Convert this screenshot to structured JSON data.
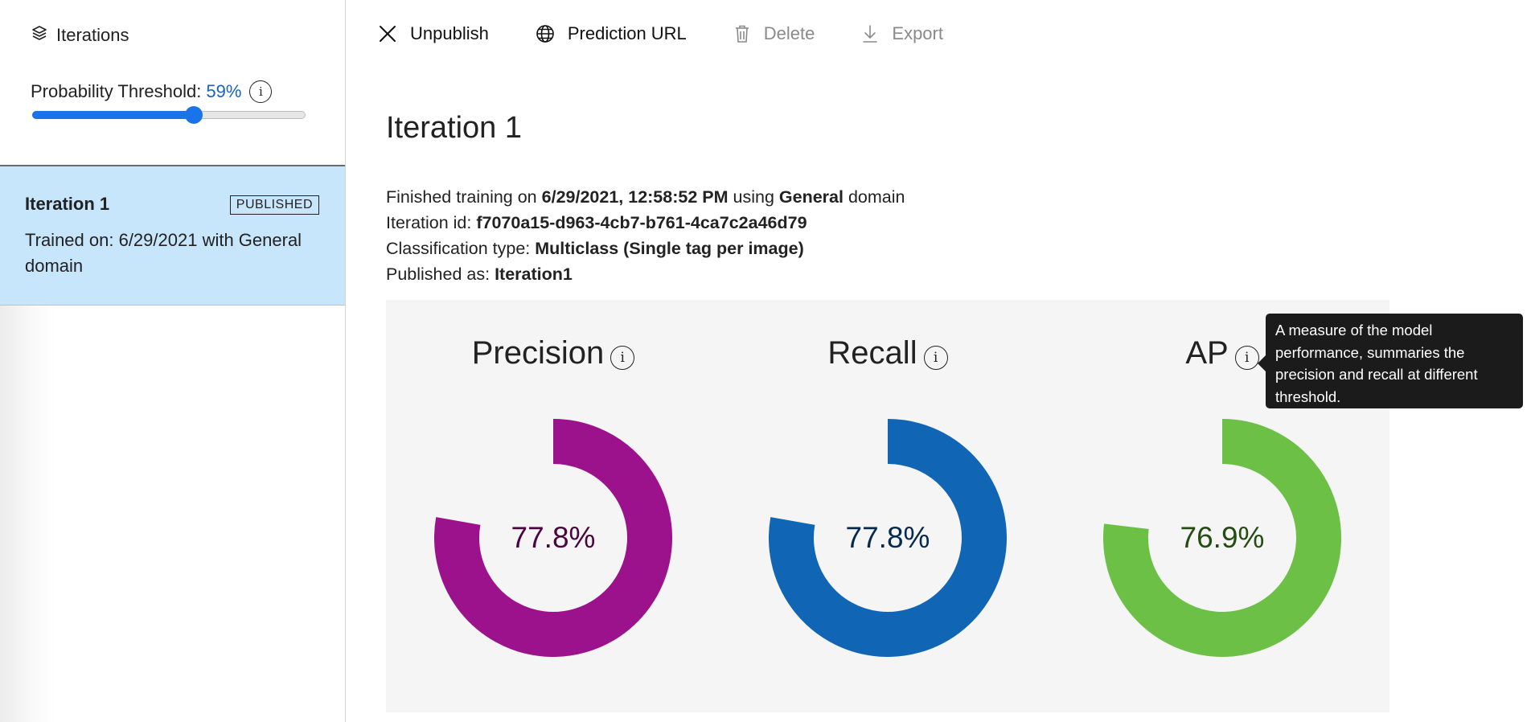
{
  "sidebar": {
    "header_label": "Iterations",
    "threshold": {
      "label": "Probability Threshold:",
      "value_text": "59%",
      "value": 0.59,
      "info": "i"
    },
    "iterations": [
      {
        "name": "Iteration 1",
        "badge": "PUBLISHED",
        "description": "Trained on: 6/29/2021 with General domain",
        "selected": true
      }
    ]
  },
  "toolbar": {
    "unpublish": "Unpublish",
    "prediction_url": "Prediction URL",
    "delete": "Delete",
    "export": "Export"
  },
  "main": {
    "title": "Iteration 1",
    "meta": {
      "finished_prefix": "Finished training on",
      "finished_date": "6/29/2021, 12:58:52 PM",
      "using_word": "using",
      "domain": "General",
      "domain_suffix": "domain",
      "iteration_id_label": "Iteration id:",
      "iteration_id": "f7070a15-d963-4cb7-b761-4ca7c2a46d79",
      "classification_label": "Classification type:",
      "classification": "Multiclass (Single tag per image)",
      "published_label": "Published as:",
      "published": "Iteration1"
    },
    "metrics": [
      {
        "name": "Precision",
        "value_text": "77.8%",
        "value": 0.778,
        "color": "#9c118c",
        "text_color": "#4a0540",
        "info": "i"
      },
      {
        "name": "Recall",
        "value_text": "77.8%",
        "value": 0.778,
        "color": "#1066b4",
        "text_color": "#062a4e",
        "info": "i"
      },
      {
        "name": "AP",
        "value_text": "76.9%",
        "value": 0.769,
        "color": "#6cc046",
        "text_color": "#234d12",
        "info": "i"
      }
    ],
    "tooltip": "A measure of the model performance, summaries the precision and recall at different threshold."
  },
  "colors": {
    "accent": "#1a73e8",
    "selected_bg": "#c7e5fb",
    "link": "#1565c0"
  }
}
